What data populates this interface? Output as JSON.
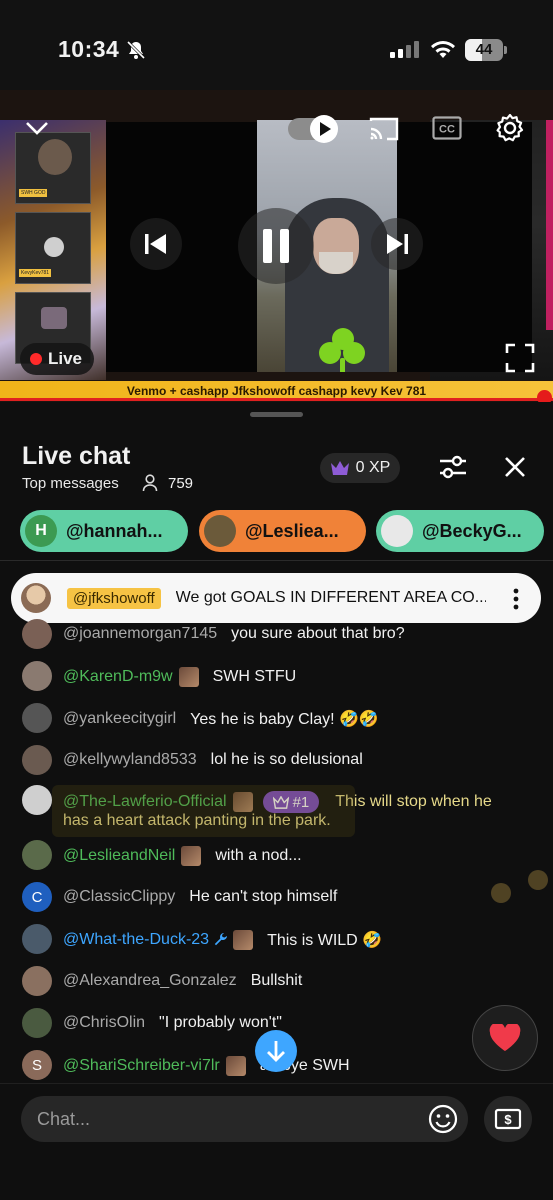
{
  "status_bar": {
    "time": "10:34",
    "battery": "44",
    "battery_level": 0.44
  },
  "player": {
    "live_label": "Live",
    "ticker": "Venmo + cashapp Jfkshowoff cashapp kevy Kev 781"
  },
  "chat": {
    "title": "Live chat",
    "mode": "Top messages",
    "viewer_count": "759",
    "xp_label": "0 XP",
    "chips": [
      {
        "initial": "H",
        "label": "@hannah...",
        "bg": "#5fcfa4",
        "avatar_bg": "#3c9a52"
      },
      {
        "initial": "",
        "label": "@Lesliea...",
        "bg": "#f08238",
        "avatar_bg": "#6b5a3a"
      },
      {
        "initial": "",
        "label": "@BeckyG...",
        "bg": "#5fcfa4",
        "avatar_bg": "#e8e8e8"
      }
    ],
    "pinned": {
      "author": "@jfkshowoff",
      "text": "We got GOALS IN DIFFERENT AREA CO..."
    },
    "messages": [
      {
        "author": "@joannemorgan7145",
        "text": "you sure about that bro?",
        "color": "gray",
        "initial": "",
        "avatar_bg": "#7a6055"
      },
      {
        "author": "@KarenD-m9w",
        "text": "SWH STFU",
        "color": "green",
        "member_badge": true,
        "initial": "",
        "avatar_bg": "#8a7a70"
      },
      {
        "author": "@yankeecitygirl",
        "text": "Yes he is baby Clay! 🤣🤣",
        "color": "gray",
        "initial": "",
        "avatar_bg": "#555555"
      },
      {
        "author": "@kellywyland8533",
        "text": "lol he is so delusional",
        "color": "gray",
        "initial": "",
        "avatar_bg": "#6a5a50"
      },
      {
        "author": "@The-Lawferio-Official",
        "rank": "#1",
        "text": "This will stop when he",
        "text_cont": "has a heart attack panting in the park.",
        "color": "green",
        "member_badge": true,
        "initial": "",
        "avatar_bg": "#cfcfcf"
      },
      {
        "author": "@LeslieandNeil",
        "text": "with a nod...",
        "color": "green",
        "member_badge": true,
        "initial": "",
        "avatar_bg": "#5a6a4a"
      },
      {
        "author": "@ClassicClippy",
        "text": "He can't stop himself",
        "color": "gray",
        "initial": "C",
        "avatar_bg": "#1f5fbf"
      },
      {
        "author": "@What-the-Duck-23",
        "text": "This is WILD 🤣",
        "color": "blue",
        "member_badge": true,
        "mod": true,
        "initial": "",
        "avatar_bg": "#4a5a6a"
      },
      {
        "author": "@Alexandrea_Gonzalez",
        "text": "Bullshit",
        "color": "gray",
        "initial": "",
        "avatar_bg": "#8a7060"
      },
      {
        "author": "@ChrisOlin",
        "text": "\"I probably won't\"",
        "color": "gray",
        "initial": "",
        "avatar_bg": "#4a5a40"
      },
      {
        "author": "@ShariSchreiber-vi7lr",
        "text": "an bye SWH",
        "color": "green",
        "member_badge": true,
        "initial": "S",
        "avatar_bg": "#8a6a5a"
      }
    ],
    "input_placeholder": "Chat..."
  },
  "colors": {
    "accent_green": "#4fbb5a",
    "accent_blue": "#3ea6ff",
    "ticker_yellow": "#f0b419",
    "live_red": "#ff2a2a"
  },
  "icons": [
    "bell-slash-icon",
    "signal-icon",
    "wifi-icon",
    "chevron-down-icon",
    "cast-icon",
    "cc-icon",
    "gear-icon",
    "previous-icon",
    "pause-icon",
    "next-icon",
    "fullscreen-icon",
    "person-icon",
    "crown-icon",
    "sliders-icon",
    "close-icon",
    "more-vert-icon",
    "heart-icon",
    "arrow-down-icon",
    "smiley-icon",
    "money-icon"
  ]
}
